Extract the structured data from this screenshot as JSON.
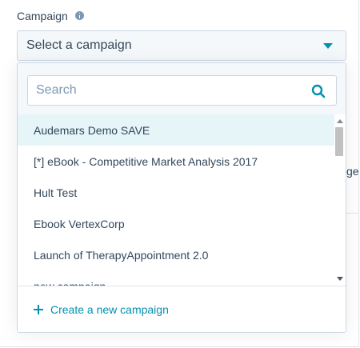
{
  "field": {
    "label": "Campaign",
    "info_icon": "info-icon"
  },
  "select": {
    "value": "Select a campaign",
    "caret_icon": "caret-down-icon"
  },
  "search": {
    "value": "",
    "placeholder": "Search",
    "icon": "search-icon"
  },
  "options": [
    {
      "label": "Audemars Demo SAVE",
      "active": true
    },
    {
      "label": "[*] eBook - Competitive Market Analysis 2017",
      "active": false
    },
    {
      "label": "Hult Test",
      "active": false
    },
    {
      "label": "Ebook VertexCorp",
      "active": false
    },
    {
      "label": "Launch of TherapyAppointment 2.0",
      "active": false
    },
    {
      "label": "new campaign",
      "active": false
    }
  ],
  "footer": {
    "create_label": "Create a new campaign",
    "plus_icon": "plus-icon"
  },
  "background": {
    "fragment": "ge"
  },
  "colors": {
    "accent": "#0091ae",
    "text": "#33475b",
    "highlight": "#e5f5f8",
    "border": "#cbd6e2",
    "muted": "#7c98b6"
  }
}
